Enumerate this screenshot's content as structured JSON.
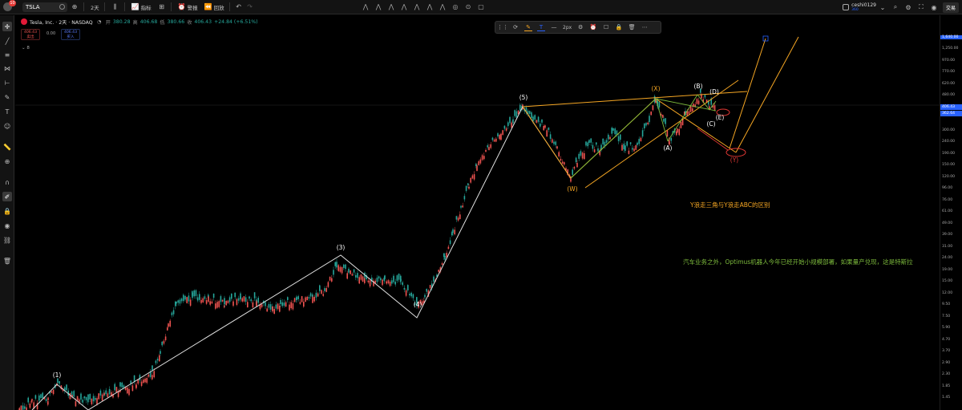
{
  "topbar": {
    "badge": "10",
    "symbol": "TSLA",
    "interval": "2天",
    "indicators_label": "指标",
    "alert_label": "警报",
    "replay_label": "回放",
    "username": "ceshi0129",
    "username_sub": "360",
    "trade_label": "交易"
  },
  "legend": {
    "title": "Tesla, Inc. · 2天 · NASDAQ",
    "open_label": "开",
    "open_value": "380.28",
    "high_label": "高",
    "high_value": "406.68",
    "low_label": "低",
    "low_value": "380.66",
    "close_label": "收",
    "close_value": "406.43",
    "change": "+24.84 (+6.51%)",
    "sell_price": "406.43",
    "sell_label": "卖出",
    "spread": "0.00",
    "buy_price": "406.43",
    "buy_label": "买入",
    "collapsed_count": "8"
  },
  "drawbar": {
    "stroke_width": "2px"
  },
  "price_axis": {
    "ticks": [
      "1,640.00",
      "1,250.00",
      "970.00",
      "770.00",
      "620.00",
      "480.00",
      "406.4",
      "362.64",
      "300.00",
      "240.00",
      "190.00",
      "150.00",
      "120.00",
      "96.00",
      "76.00",
      "61.00",
      "49.00",
      "39.00",
      "31.00",
      "24.00",
      "19.00",
      "15.00",
      "12.00",
      "9.50",
      "7.50",
      "5.90",
      "4.70",
      "3.70",
      "2.90",
      "2.30",
      "1.85",
      "1.45"
    ],
    "current_price": "406.43",
    "current_color": "#2962ff",
    "level_price": "362.64",
    "level_color": "#2962ff",
    "top_price": "1,640.00",
    "top_color": "#2962ff"
  },
  "waves": {
    "w1": "(1)",
    "w3": "(3)",
    "w4": "(4)",
    "w5": "(5)",
    "ww": "(W)",
    "wx": "(X)",
    "wy": "(Y)",
    "wa": "(A)",
    "wb": "(B)",
    "wc": "(C)",
    "wd": "(D)",
    "we": "(E)"
  },
  "annotations": {
    "note_orange": "Y浪走三角与Y浪走ABC的区别",
    "note_green": "汽车业务之外，Optimus机器人今年已经开始小规模部署，如果量产兑现，这是特斯拉"
  },
  "colors": {
    "accent": "#2962ff",
    "orange": "#f5a623",
    "green": "#7dbb3c",
    "red": "#e53935",
    "up": "#26a69a",
    "down": "#ef5350"
  }
}
